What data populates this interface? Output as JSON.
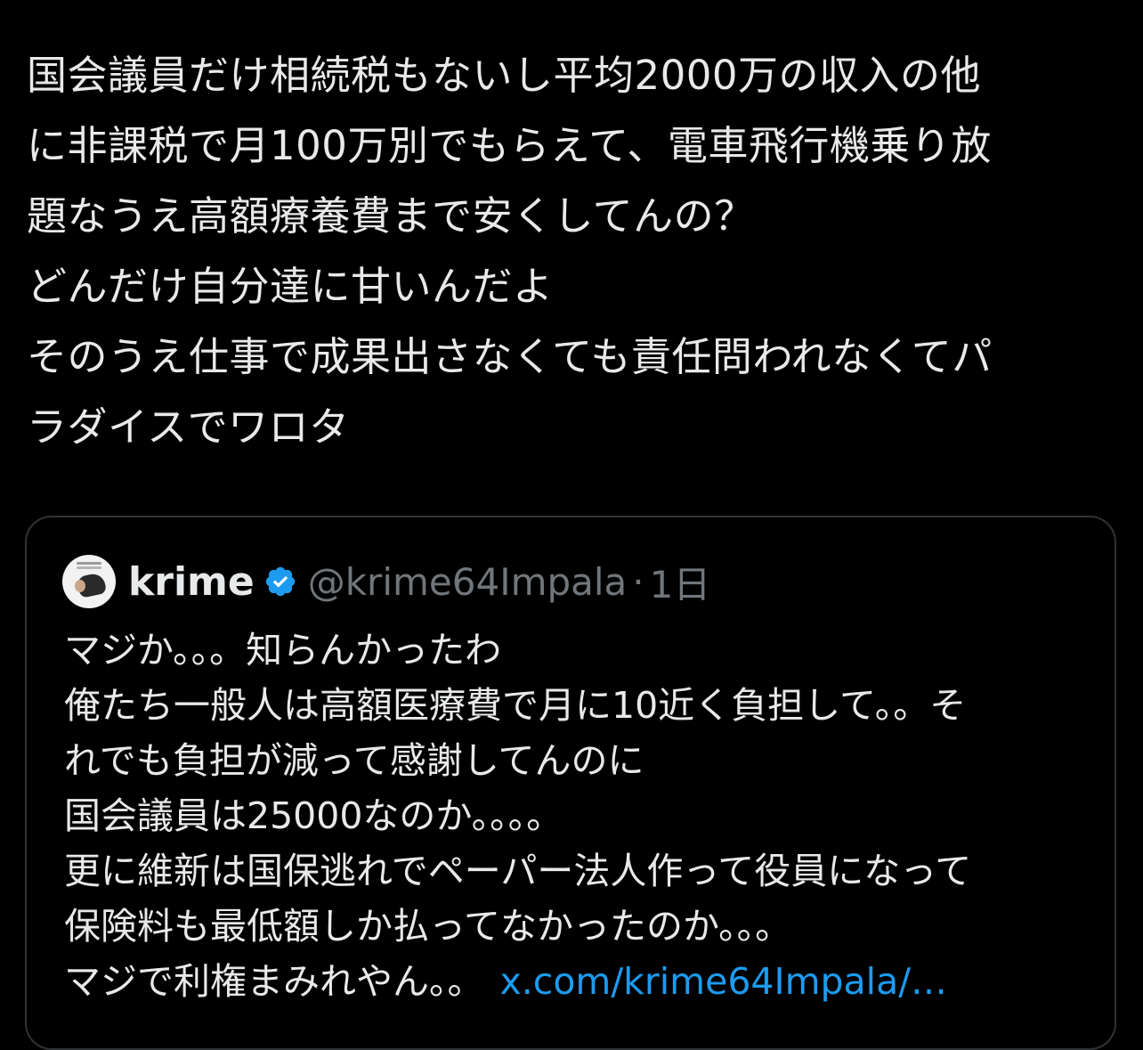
{
  "post": {
    "lines": [
      "国会議員だけ相続税もないし平均2000万の収入の他",
      "に非課税で月100万別でもらえて、電車飛行機乗り放",
      "題なうえ高額療養費まで安くしてんの？",
      "どんだけ自分達に甘いんだよ",
      "そのうえ仕事で成果出さなくても責任問われなくてパ",
      "ラダイスでワロタ"
    ]
  },
  "quote": {
    "display_name": "krime",
    "handle": "@krime64Impala",
    "separator": "·",
    "time": "1日",
    "lines": [
      "マジか。。。知らんかったわ",
      "俺たち一般人は高額医療費で月に10近く負担して。。そ",
      "れでも負担が減って感謝してんのに",
      "国会議員は25000なのか。。。。",
      "更に維新は国保逃れでペーパー法人作って役員になって",
      "保険料も最低額しか払ってなかったのか。。。",
      "マジで利権まみれやん。。"
    ],
    "link": "x.com/krime64Impala/…"
  },
  "colors": {
    "background": "#000000",
    "text": "#e7e9ea",
    "muted": "#71767b",
    "link": "#1d9bf0",
    "border": "#2f3336",
    "verified": "#1d9bf0"
  },
  "icons": {
    "verified": "verified-badge-icon"
  }
}
